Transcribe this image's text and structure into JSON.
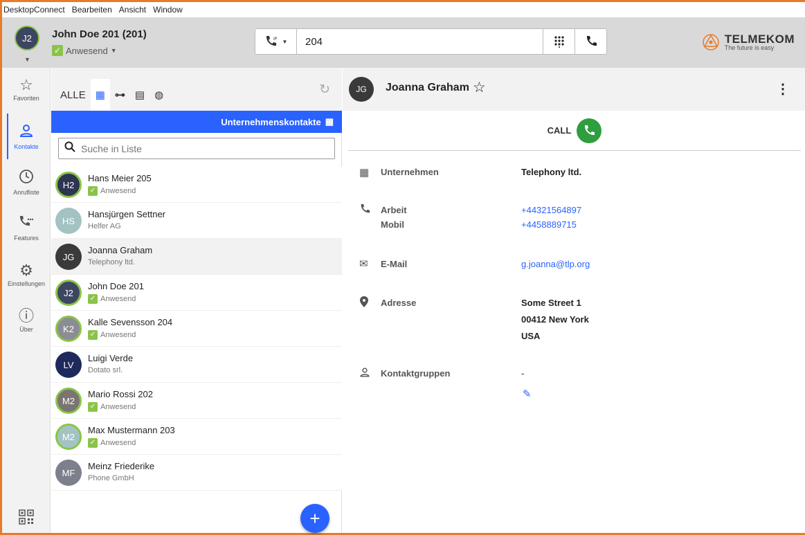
{
  "menu": [
    "DesktopConnect",
    "Bearbeiten",
    "Ansicht",
    "Window"
  ],
  "header": {
    "user_initials": "J2",
    "user_name": "John Doe 201 (201)",
    "user_status": "Anwesend",
    "dial_mode": "IP",
    "dial_value": "204",
    "logo_brand": "TELMEKOM",
    "logo_tag": "The future is easy",
    "accent": "#e87b2a"
  },
  "nav": [
    {
      "label": "Favoriten",
      "icon": "star-icon"
    },
    {
      "label": "Kontakte",
      "icon": "person-icon",
      "active": true
    },
    {
      "label": "Anrufliste",
      "icon": "clock-icon"
    },
    {
      "label": "Features",
      "icon": "phone-features-icon"
    },
    {
      "label": "Einstellungen",
      "icon": "gear-icon"
    },
    {
      "label": "Über",
      "icon": "info-icon"
    }
  ],
  "contacts": {
    "tab_all": "ALLE",
    "banner": "Unternehmenskontakte",
    "search_placeholder": "Suche in Liste",
    "items": [
      {
        "initials": "H2",
        "name": "Hans Meier 205",
        "sub": "Anwesend",
        "status": true,
        "color": "#2c3552"
      },
      {
        "initials": "HS",
        "name": "Hansjürgen Settner",
        "sub": "Helfer AG",
        "status": false,
        "color": "#a3c3c2"
      },
      {
        "initials": "JG",
        "name": "Joanna Graham",
        "sub": "Telephony ltd.",
        "status": false,
        "color": "#3a3a3a"
      },
      {
        "initials": "J2",
        "name": "John Doe 201",
        "sub": "Anwesend",
        "status": true,
        "color": "#3d4660"
      },
      {
        "initials": "K2",
        "name": "Kalle Sevensson 204",
        "sub": "Anwesend",
        "status": true,
        "color": "#8c8c94"
      },
      {
        "initials": "LV",
        "name": "Luigi Verde",
        "sub": "Dotato srl.",
        "status": false,
        "color": "#1f2a5c"
      },
      {
        "initials": "M2",
        "name": "Mario Rossi 202",
        "sub": "Anwesend",
        "status": true,
        "color": "#7a7572"
      },
      {
        "initials": "M2",
        "name": "Max Mustermann 203",
        "sub": "Anwesend",
        "status": true,
        "color": "#a3c3c2"
      },
      {
        "initials": "MF",
        "name": "Meinz Friederike",
        "sub": "Phone GmbH",
        "status": false,
        "color": "#7d7f8c"
      }
    ]
  },
  "detail": {
    "initials": "JG",
    "name": "Joanna Graham",
    "call_label": "CALL",
    "company_label": "Unternehmen",
    "company_value": "Telephony ltd.",
    "work_label": "Arbeit",
    "work_value": "+44321564897",
    "mobile_label": "Mobil",
    "mobile_value": "+4458889715",
    "email_label": "E-Mail",
    "email_value": "g.joanna@tlp.org",
    "address_label": "Adresse",
    "address_line1": "Some Street 1",
    "address_line2": "00412 New York",
    "address_line3": "USA",
    "groups_label": "Kontaktgruppen",
    "groups_value": "-"
  }
}
